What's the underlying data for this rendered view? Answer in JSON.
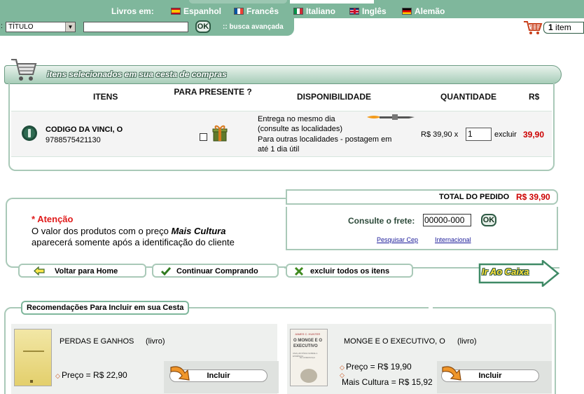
{
  "header": {
    "lang_label": "Livros em:",
    "languages": [
      "Espanhol",
      "Francês",
      "Italiano",
      "Inglês",
      "Alemão"
    ],
    "search_prefix": ":",
    "search_type_value": "TÍTULO",
    "search_ok": "OK",
    "advanced_search": ":: busca avançada",
    "cart_count_number": "1",
    "cart_count_label": "item"
  },
  "cart": {
    "title": "itens selecionados em sua cesta de compras",
    "columns": {
      "items": "ITENS",
      "gift": "PARA PRESENTE ?",
      "availability": "DISPONIBILIDADE",
      "quantity": "QUANTIDADE",
      "currency": "R$"
    },
    "item": {
      "title": "CODIGO DA VINCI, O",
      "isbn": "9788575421130",
      "availability_line1": "Entrega no mesmo dia",
      "availability_line2": "(consulte as localidades)",
      "availability_line3": "Para outras localidades - postagem em",
      "availability_line4": "até 1 dia útil",
      "unit_price": "R$ 39,90 x",
      "quantity": "1",
      "remove_label": "excluir",
      "total": "39,90"
    }
  },
  "order": {
    "total_label": "TOTAL DO PEDIDO",
    "total_value": "R$ 39,90",
    "freight_label": "Consulte o frete:",
    "cep_value": "00000-000",
    "freight_ok": "OK",
    "link_cep": "Pesquisar Cep",
    "link_international": "Internacional"
  },
  "attention": {
    "heading": "* Atenção",
    "line1_before": "O valor dos produtos com o preço",
    "line1_brand": "Mais Cultura",
    "line2": "aparecerá somente após a identificação do cliente"
  },
  "actions": {
    "home": "Voltar para Home",
    "continue": "Continuar Comprando",
    "clear": "excluir todos os itens",
    "checkout": "Ir Ao Caixa"
  },
  "recommendations": {
    "title": "Recomendações Para Incluir em sua Cesta",
    "items": [
      {
        "title": "PERDAS E GANHOS",
        "type": "(livro)",
        "price_label": "Preço = R$ 22,90",
        "include_label": "Incluir"
      },
      {
        "title": "MONGE E O EXECUTIVO, O",
        "type": "(livro)",
        "price_label": "Preço = R$ 19,90",
        "extra_label": "Mais Cultura = R$ 15,92",
        "include_label": "Incluir",
        "cover_lines": [
          "JAMES C. HUNTER",
          "O MONGE E O",
          "EXECUTIVO",
          "UMA HISTÓRIA SOBRE A ESSÊNCIA",
          "DA LIDERANÇA"
        ]
      }
    ]
  },
  "colors": {
    "brand_green": "#7fb79c",
    "border_green": "#a9c9b8",
    "price_red": "#cc0000",
    "attention_red": "#e01b1b"
  }
}
